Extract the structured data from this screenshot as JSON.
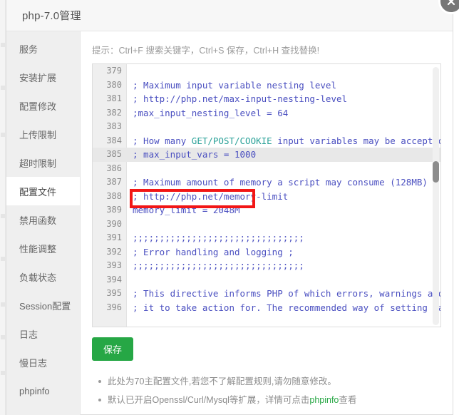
{
  "window": {
    "title": "php-7.0管理",
    "close_icon": "close-circle-icon"
  },
  "sidebar": {
    "items": [
      {
        "label": "服务",
        "active": false
      },
      {
        "label": "安装扩展",
        "active": false
      },
      {
        "label": "配置修改",
        "active": false
      },
      {
        "label": "上传限制",
        "active": false
      },
      {
        "label": "超时限制",
        "active": false
      },
      {
        "label": "配置文件",
        "active": true
      },
      {
        "label": "禁用函数",
        "active": false
      },
      {
        "label": "性能调整",
        "active": false
      },
      {
        "label": "负载状态",
        "active": false
      },
      {
        "label": "Session配置",
        "active": false
      },
      {
        "label": "日志",
        "active": false
      },
      {
        "label": "慢日志",
        "active": false
      },
      {
        "label": "phpinfo",
        "active": false
      }
    ]
  },
  "main": {
    "hint": "提示：Ctrl+F 搜索关键字，Ctrl+S 保存，Ctrl+H 查找替换!",
    "save_label": "保存",
    "notes": [
      "此处为70主配置文件,若您不了解配置规则,请勿随意修改。",
      "默认已开启Openssl/Curl/Mysql等扩展，详情可点击"
    ],
    "note2_link": "phpinfo",
    "note2_tail": "查看"
  },
  "editor": {
    "first_visible_line": 379,
    "active_line": 385,
    "highlight_line": 389,
    "scroll_thumb_top_pct": 36,
    "lines": [
      {
        "no": "379",
        "text": ""
      },
      {
        "no": "380",
        "text": "; Maximum input variable nesting level"
      },
      {
        "no": "381",
        "text": "; http://php.net/max-input-nesting-level"
      },
      {
        "no": "382",
        "text": ";max_input_nesting_level = 64"
      },
      {
        "no": "383",
        "text": ""
      },
      {
        "no": "384",
        "text": "; How many GET/POST/COOKIE input variables may be accepted",
        "kw": "GET/POST/COOKIE"
      },
      {
        "no": "385",
        "text": "; max_input_vars = 1000",
        "active": true,
        "caret": true
      },
      {
        "no": "386",
        "text": ""
      },
      {
        "no": "387",
        "text": "; Maximum amount of memory a script may consume (128MB)"
      },
      {
        "no": "388",
        "text": "; http://php.net/memory-limit"
      },
      {
        "no": "389",
        "text": "memory_limit = 2048M",
        "boxed": true
      },
      {
        "no": "390",
        "text": ""
      },
      {
        "no": "391",
        "text": ";;;;;;;;;;;;;;;;;;;;;;;;;;;;;;;;"
      },
      {
        "no": "392",
        "text": "; Error handling and logging ;"
      },
      {
        "no": "393",
        "text": ";;;;;;;;;;;;;;;;;;;;;;;;;;;;;;;;"
      },
      {
        "no": "394",
        "text": ""
      },
      {
        "no": "395",
        "text": "; This directive informs PHP of which errors, warnings and notices you would like"
      },
      {
        "no": "396",
        "text": "; it to take action for. The recommended way of setting values for this"
      }
    ]
  }
}
